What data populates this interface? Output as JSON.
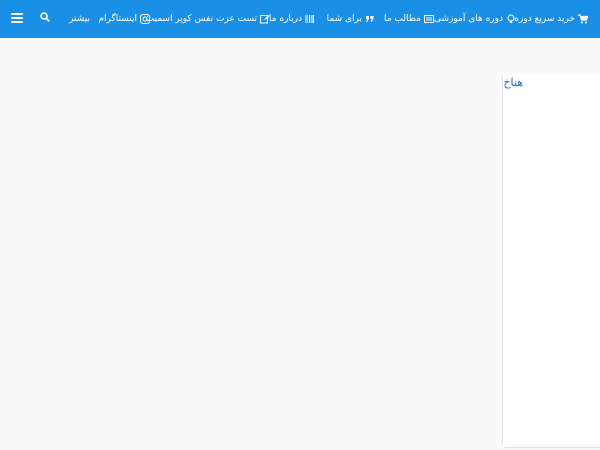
{
  "navbar": {
    "bg_color": "#1a8fe6",
    "items": [
      {
        "label": "خرید سریع دوره",
        "icon": "cart-icon"
      },
      {
        "label": "دوره های آموزشی",
        "icon": "bulb-icon"
      },
      {
        "label": "مطالب ما",
        "icon": "newspaper-icon"
      },
      {
        "label": "برای شما",
        "icon": "quote-icon"
      },
      {
        "label": "درباره ما",
        "icon": "barcode-icon"
      },
      {
        "label": "تست عزت نفس کوپر اسمیت",
        "icon": "edit-icon"
      },
      {
        "label": "اینستاگرام",
        "icon": "instagram-icon"
      },
      {
        "label": "بیشتر",
        "icon": ""
      }
    ],
    "search_icon": "search-icon",
    "menu_icon": "hamburger-icon"
  },
  "sidebar": {
    "title": "هناخ"
  }
}
